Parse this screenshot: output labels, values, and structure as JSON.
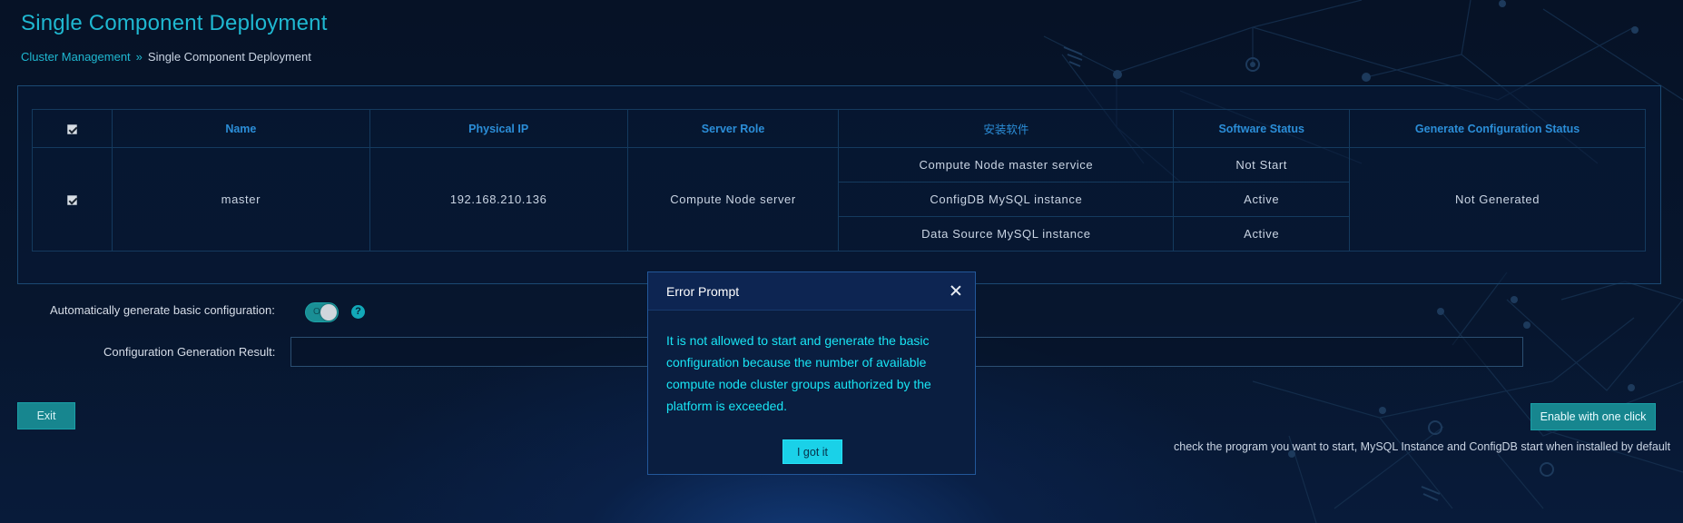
{
  "page": {
    "title": "Single Component Deployment"
  },
  "breadcrumb": {
    "parent": "Cluster Management",
    "current": "Single Component Deployment"
  },
  "table": {
    "headers": {
      "name": "Name",
      "physical_ip": "Physical IP",
      "server_role": "Server Role",
      "software": "安装软件",
      "software_status": "Software Status",
      "gen_config_status": "Generate Configuration Status"
    },
    "rows": [
      {
        "name": "master",
        "physical_ip": "192.168.210.136",
        "server_role": "Compute Node server",
        "software": [
          {
            "name": "Compute Node master service",
            "status": "Not Start"
          },
          {
            "name": "ConfigDB MySQL instance",
            "status": "Active"
          },
          {
            "name": "Data Source MySQL instance",
            "status": "Active"
          }
        ],
        "gen_config_status": "Not Generated"
      }
    ]
  },
  "options": {
    "auto_generate_label": "Automatically generate basic configuration:",
    "toggle_text": "On",
    "result_label": "Configuration Generation Result:",
    "result_value": ""
  },
  "actions": {
    "exit_label": "Exit",
    "enable_label": "Enable with one click",
    "hint": "check the program you want to start, MySQL Instance and ConfigDB start when installed by default"
  },
  "modal": {
    "title": "Error Prompt",
    "message": "It is not allowed to start and generate the basic configuration because the number of available compute node cluster groups authorized by the platform is exceeded.",
    "ok_label": "I got it"
  },
  "colors": {
    "accent": "#1fb8d1",
    "header_text": "#2b8ed8",
    "modal_text": "#19e4f4",
    "button": "#17868f"
  }
}
